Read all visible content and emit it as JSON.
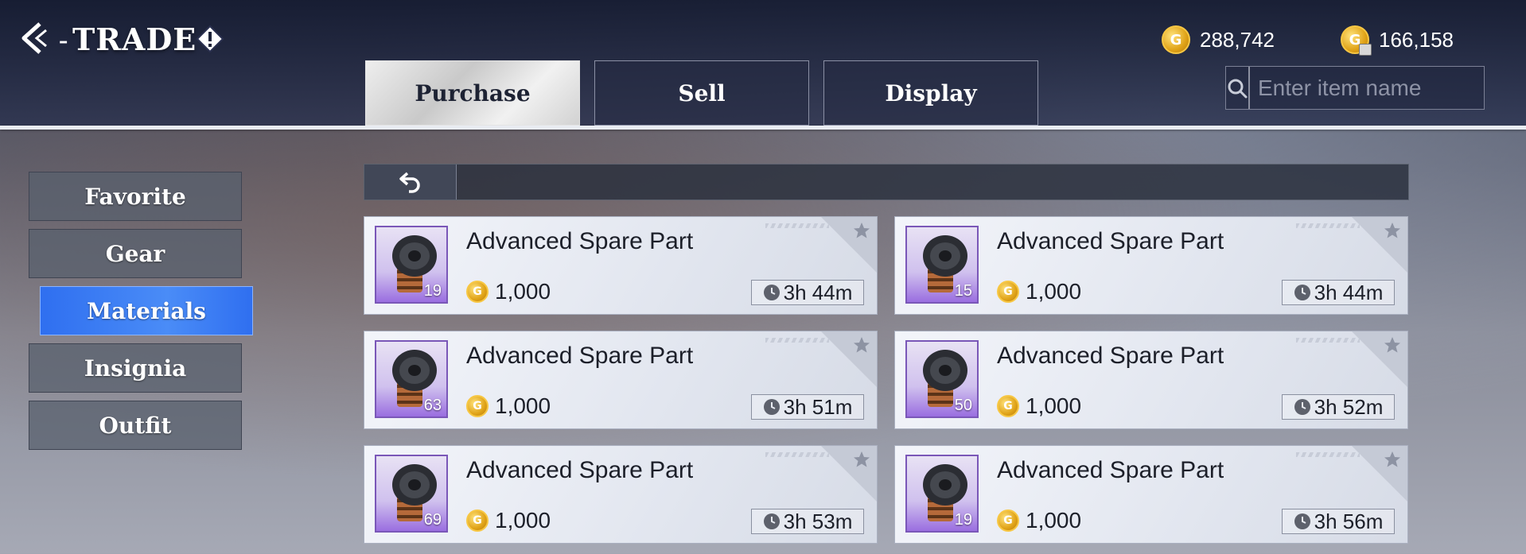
{
  "header": {
    "title": "TRADE",
    "dash": "-",
    "currencies": [
      {
        "icon": "gold-coin-icon",
        "value": "288,742"
      },
      {
        "icon": "locked-coin-icon",
        "value": "166,158"
      }
    ],
    "search": {
      "placeholder": "Enter item name",
      "value": ""
    }
  },
  "tabs": [
    {
      "label": "Purchase",
      "active": true
    },
    {
      "label": "Sell",
      "active": false
    },
    {
      "label": "Display",
      "active": false
    }
  ],
  "sidebar": {
    "items": [
      {
        "label": "Favorite",
        "active": false
      },
      {
        "label": "Gear",
        "active": false
      },
      {
        "label": "Materials",
        "active": true
      },
      {
        "label": "Insignia",
        "active": false
      },
      {
        "label": "Outfit",
        "active": false
      }
    ]
  },
  "listings": [
    {
      "name": "Advanced Spare Part",
      "count": "19",
      "price": "1,000",
      "time": "3h 44m"
    },
    {
      "name": "Advanced Spare Part",
      "count": "15",
      "price": "1,000",
      "time": "3h 44m"
    },
    {
      "name": "Advanced Spare Part",
      "count": "63",
      "price": "1,000",
      "time": "3h 51m"
    },
    {
      "name": "Advanced Spare Part",
      "count": "50",
      "price": "1,000",
      "time": "3h 52m"
    },
    {
      "name": "Advanced Spare Part",
      "count": "69",
      "price": "1,000",
      "time": "3h 53m"
    },
    {
      "name": "Advanced Spare Part",
      "count": "19",
      "price": "1,000",
      "time": "3h 56m"
    }
  ],
  "colors": {
    "accent": "#3b7df4",
    "rarity": "#7a57b8",
    "gold": "#e0a318"
  }
}
